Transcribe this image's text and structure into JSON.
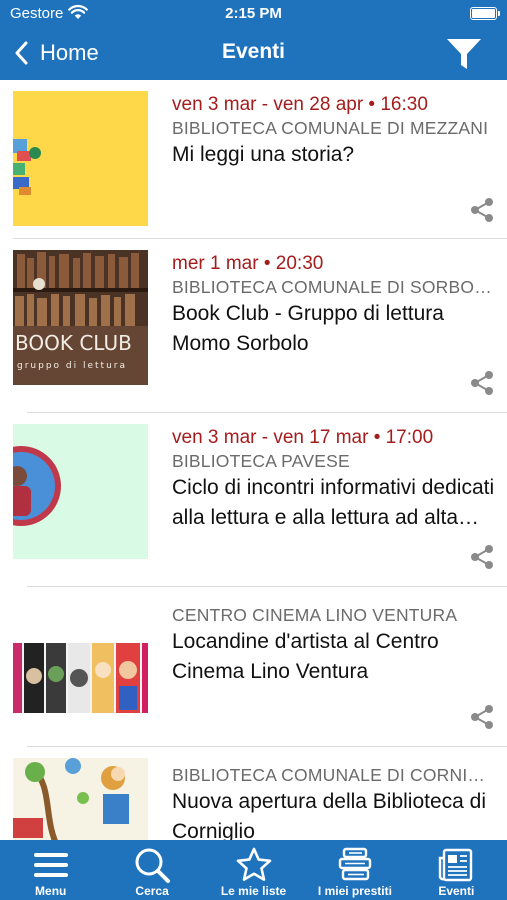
{
  "status_bar": {
    "carrier": "Gestore",
    "time": "2:15 PM"
  },
  "nav": {
    "back_label": "Home",
    "title": "Eventi"
  },
  "events": [
    {
      "date": "ven 3 mar - ven 28 apr • 16:30",
      "place": "BIBLIOTECA COMUNALE DI MEZZANI",
      "title": "Mi leggi una storia?"
    },
    {
      "date": "mer 1 mar • 20:30",
      "place": "BIBLIOTECA COMUNALE DI SORBOLO",
      "title": "Book Club - Gruppo di lettura Momo Sorbolo",
      "thumb_text": "BOOK CLUB",
      "thumb_subtext": "gruppo di lettura"
    },
    {
      "date": "ven 3 mar - ven 17 mar • 17:00",
      "place": "BIBLIOTECA PAVESE",
      "title": "Ciclo di incontri informativi dedicati alla lettura e alla lettura ad alta voce"
    },
    {
      "date": "",
      "place": "CENTRO CINEMA LINO VENTURA",
      "title": "Locandine d'artista al Centro Cinema Lino Ventura"
    },
    {
      "date": "",
      "place": "BIBLIOTECA COMUNALE DI CORNIGLIO",
      "title": "Nuova apertura della Biblioteca di Corniglio"
    }
  ],
  "tabs": [
    {
      "label": "Menu",
      "icon": "menu-icon"
    },
    {
      "label": "Cerca",
      "icon": "search-icon"
    },
    {
      "label": "Le mie liste",
      "icon": "star-icon"
    },
    {
      "label": "I miei prestiti",
      "icon": "books-icon"
    },
    {
      "label": "Eventi",
      "icon": "newspaper-icon"
    }
  ],
  "colors": {
    "brand_blue": "#1f73bd",
    "date_red": "#a51c1c",
    "place_gray": "#6b6b6b"
  }
}
